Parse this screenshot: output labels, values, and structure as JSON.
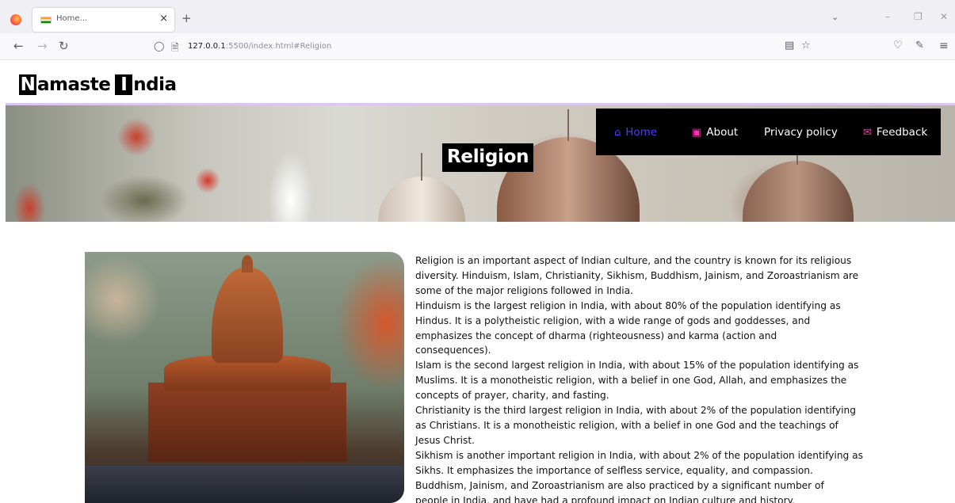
{
  "browser": {
    "tab_title": "Home...",
    "tab_close": "×",
    "new_tab": "+",
    "url_host": "127.0.0.1",
    "url_rest": ":5500/index.html#Religion"
  },
  "site": {
    "logo_letter1": "N",
    "logo_word1": "amaste",
    "logo_letter2": "I",
    "logo_word2": "ndia",
    "page_title": "Religion"
  },
  "menu": {
    "items": [
      {
        "label": "Home",
        "icon": "home-icon",
        "active": true
      },
      {
        "label": "About",
        "icon": "id-card-icon",
        "active": false
      },
      {
        "label": "Privacy policy",
        "icon": "",
        "active": false
      },
      {
        "label": "Feedback",
        "icon": "envelope-icon",
        "active": false
      }
    ]
  },
  "colors": {
    "menu_background": "#000000",
    "menu_active": "#4d3bff",
    "menu_icon": "#ff2fb0",
    "hero_border": "#d9c7f2"
  },
  "article": {
    "lines": [
      "Religion is an important aspect of Indian culture, and the country is known for its religious",
      "diversity. Hinduism, Islam, Christianity, Sikhism, Buddhism, Jainism, and Zoroastrianism are",
      "some of the major religions followed in India.",
      "Hinduism is the largest religion in India, with about 80% of the population identifying as",
      "Hindus. It is a polytheistic religion, with a wide range of gods and goddesses, and",
      "emphasizes the concept of dharma (righteousness) and karma (action and",
      "consequences).",
      "Islam is the second largest religion in India, with about 15% of the population identifying as",
      "Muslims. It is a monotheistic religion, with a belief in one God, Allah, and emphasizes the",
      "concepts of prayer, charity, and fasting.",
      "Christianity is the third largest religion in India, with about 2% of the population identifying",
      "as Christians. It is a monotheistic religion, with a belief in one God and the teachings of",
      "Jesus Christ.",
      "Sikhism is another important religion in India, with about 2% of the population identifying as",
      "Sikhs. It emphasizes the importance of selfless service, equality, and compassion.",
      "Buddhism, Jainism, and Zoroastrianism are also practiced by a significant number of",
      "people in India, and have had a profound impact on Indian culture and history."
    ]
  }
}
